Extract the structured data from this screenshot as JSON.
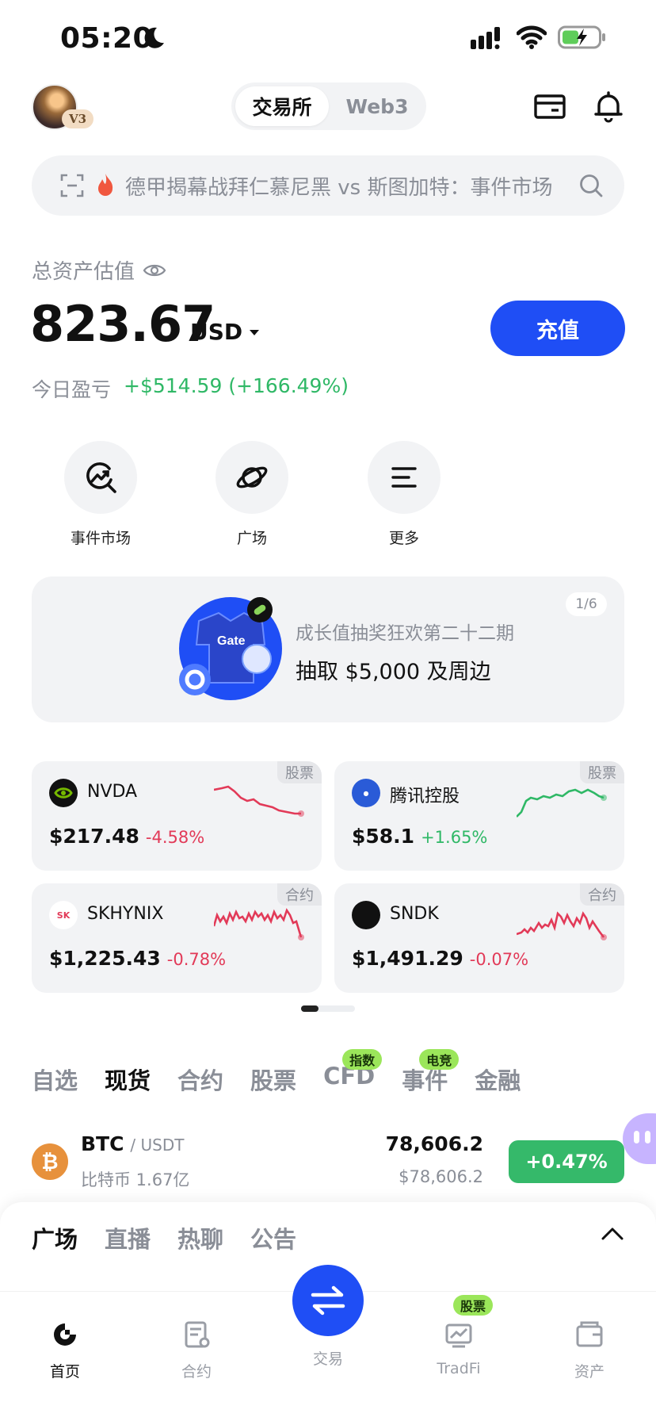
{
  "status_bar": {
    "time": "05:20"
  },
  "header": {
    "level_badge": "V3",
    "segments": [
      "交易所",
      "Web3"
    ]
  },
  "search": {
    "placeholder": "德甲揭幕战拜仁慕尼黑 vs 斯图加特：事件市场"
  },
  "assets": {
    "label": "总资产估值",
    "value": "823.67",
    "unit": "USD",
    "deposit_label": "充值",
    "pnl_label": "今日盈亏",
    "pnl_value": "+$514.59 (+166.49%)"
  },
  "shortcuts": [
    {
      "label": "事件市场",
      "icon": "trend-search-icon"
    },
    {
      "label": "广场",
      "icon": "planet-icon"
    },
    {
      "label": "更多",
      "icon": "menu-icon"
    }
  ],
  "banner": {
    "page": "1/6",
    "subtitle": "成长值抽奖狂欢第二十二期",
    "title": "抽取 $5,000 及周边"
  },
  "cards": [
    {
      "name": "NVDA",
      "tag": "股票",
      "price": "$217.48",
      "change": "-4.58%",
      "trend": "down"
    },
    {
      "name": "腾讯控股",
      "tag": "股票",
      "price": "$58.1",
      "change": "+1.65%",
      "trend": "up"
    },
    {
      "name": "SKHYNIX",
      "tag": "合约",
      "price": "$1,225.43",
      "change": "-0.78%",
      "trend": "down"
    },
    {
      "name": "SNDK",
      "tag": "合约",
      "price": "$1,491.29",
      "change": "-0.07%",
      "trend": "down"
    }
  ],
  "market_tabs": [
    {
      "label": "自选",
      "badge": ""
    },
    {
      "label": "现货",
      "badge": ""
    },
    {
      "label": "合约",
      "badge": ""
    },
    {
      "label": "股票",
      "badge": ""
    },
    {
      "label": "CFD",
      "badge": "指数"
    },
    {
      "label": "事件",
      "badge": "电竞"
    },
    {
      "label": "金融",
      "badge": ""
    }
  ],
  "market_row": {
    "base": "BTC",
    "quote": "/ USDT",
    "subtitle": "比特币 1.67亿",
    "last": "78,606.2",
    "fiat": "$78,606.2",
    "change": "+0.47%"
  },
  "sheet_tabs": [
    "广场",
    "直播",
    "热聊",
    "公告"
  ],
  "nav": [
    {
      "label": "首页"
    },
    {
      "label": "合约"
    },
    {
      "label": "交易"
    },
    {
      "label": "TradFi",
      "badge": "股票"
    },
    {
      "label": "资产"
    }
  ],
  "colors": {
    "accent": "#1f4ef5",
    "up": "#2fb866",
    "down": "#e23a58"
  }
}
